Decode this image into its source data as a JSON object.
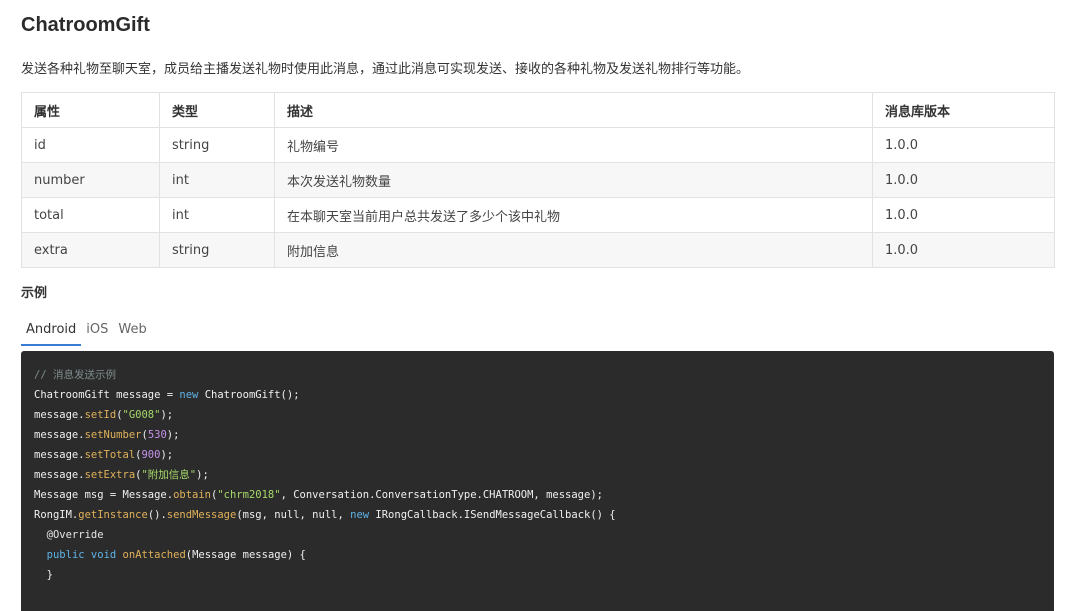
{
  "page": {
    "title": "ChatroomGift",
    "description": "发送各种礼物至聊天室，成员给主播发送礼物时使用此消息，通过此消息可实现发送、接收的各种礼物及发送礼物排行等功能。"
  },
  "table": {
    "headers": [
      "属性",
      "类型",
      "描述",
      "消息库版本"
    ],
    "rows": [
      [
        "id",
        "string",
        "礼物编号",
        "1.0.0"
      ],
      [
        "number",
        "int",
        "本次发送礼物数量",
        "1.0.0"
      ],
      [
        "total",
        "int",
        "在本聊天室当前用户总共发送了多少个该中礼物",
        "1.0.0"
      ],
      [
        "extra",
        "string",
        "附加信息",
        "1.0.0"
      ]
    ]
  },
  "example": {
    "title": "示例",
    "tabs": [
      "Android",
      "iOS",
      "Web"
    ],
    "active_tab": "Android",
    "code_lines": [
      [
        {
          "t": "// 消息发送示例",
          "c": "comment"
        }
      ],
      [
        {
          "t": "ChatroomGift message = "
        },
        {
          "t": "new",
          "c": "kw"
        },
        {
          "t": " ChatroomGift();"
        }
      ],
      [
        {
          "t": "message."
        },
        {
          "t": "setId",
          "c": "fn"
        },
        {
          "t": "("
        },
        {
          "t": "\"G008\"",
          "c": "str"
        },
        {
          "t": ");"
        }
      ],
      [
        {
          "t": "message."
        },
        {
          "t": "setNumber",
          "c": "fn"
        },
        {
          "t": "("
        },
        {
          "t": "530",
          "c": "num"
        },
        {
          "t": ");"
        }
      ],
      [
        {
          "t": "message."
        },
        {
          "t": "setTotal",
          "c": "fn"
        },
        {
          "t": "("
        },
        {
          "t": "900",
          "c": "num"
        },
        {
          "t": ");"
        }
      ],
      [
        {
          "t": "message."
        },
        {
          "t": "setExtra",
          "c": "fn"
        },
        {
          "t": "("
        },
        {
          "t": "\"附加信息\"",
          "c": "str"
        },
        {
          "t": ");"
        }
      ],
      [
        {
          "t": "Message msg = Message."
        },
        {
          "t": "obtain",
          "c": "fn"
        },
        {
          "t": "("
        },
        {
          "t": "\"chrm2018\"",
          "c": "str"
        },
        {
          "t": ", Conversation.ConversationType.CHATROOM, message);"
        }
      ],
      [
        {
          "t": "RongIM."
        },
        {
          "t": "getInstance",
          "c": "fn"
        },
        {
          "t": "()."
        },
        {
          "t": "sendMessage",
          "c": "fn"
        },
        {
          "t": "(msg, null, null, "
        },
        {
          "t": "new",
          "c": "kw"
        },
        {
          "t": " IRongCallback.ISendMessageCallback() {"
        }
      ],
      [
        {
          "t": "  @Override",
          "c": "ann"
        }
      ],
      [
        {
          "t": "  "
        },
        {
          "t": "public",
          "c": "kw"
        },
        {
          "t": " "
        },
        {
          "t": "void",
          "c": "kw"
        },
        {
          "t": " "
        },
        {
          "t": "onAttached",
          "c": "fn"
        },
        {
          "t": "(Message message) {"
        }
      ],
      [
        {
          "t": "  }"
        }
      ]
    ]
  },
  "colors": {
    "code_background": "#2b2b2b",
    "active_tab_underline": "#3a7bd5"
  }
}
